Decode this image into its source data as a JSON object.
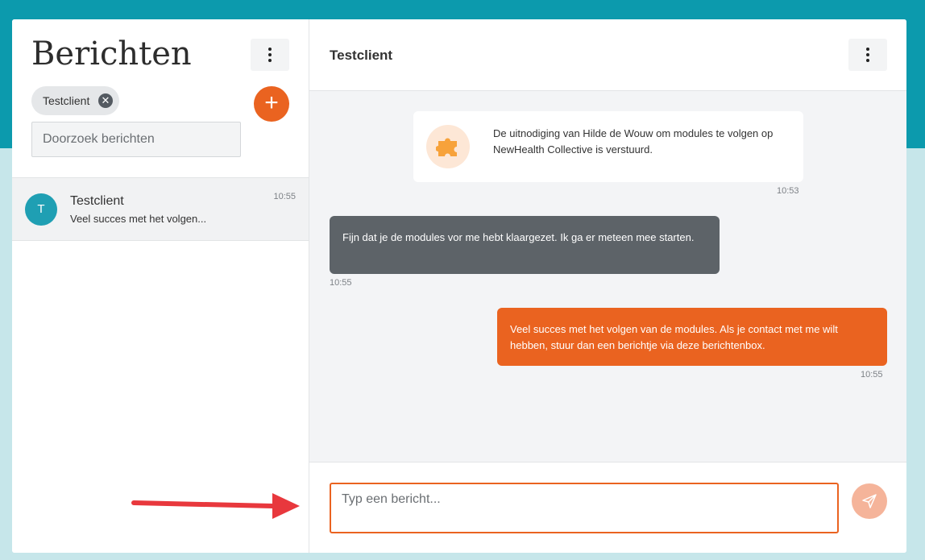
{
  "colors": {
    "brand_teal": "#0c9aad",
    "accent_orange": "#ea6320",
    "incoming_bubble": "#5d6368",
    "annotation_arrow": "#e8383d"
  },
  "sidebar": {
    "title": "Berichten",
    "menu_icon": "kebab-menu-icon",
    "filter_chip": {
      "label": "Testclient",
      "remove_icon": "close-icon"
    },
    "add_icon": "plus-icon",
    "search": {
      "placeholder": "Doorzoek berichten",
      "value": ""
    },
    "conversations": [
      {
        "avatar_initial": "T",
        "name": "Testclient",
        "preview": "Veel succes met het volgen...",
        "time": "10:55"
      }
    ]
  },
  "chat": {
    "title": "Testclient",
    "menu_icon": "kebab-menu-icon",
    "messages": [
      {
        "type": "system",
        "icon": "puzzle-icon",
        "text": "De uitnodiging van Hilde de Wouw om modules te volgen op NewHealth Collective is verstuurd.",
        "time": "10:53"
      },
      {
        "type": "incoming",
        "text": "Fijn dat je de modules vor me hebt klaargezet. Ik ga er meteen mee starten.",
        "time": "10:55"
      },
      {
        "type": "outgoing",
        "text": "Veel succes met het volgen van de modules. Als je contact met me wilt hebben, stuur dan een berichtje via deze berichtenbox.",
        "time": "10:55"
      }
    ],
    "composer": {
      "placeholder": "Typ een bericht...",
      "value": "",
      "send_icon": "send-icon"
    }
  },
  "annotation": {
    "icon": "red-arrow-annotation"
  }
}
